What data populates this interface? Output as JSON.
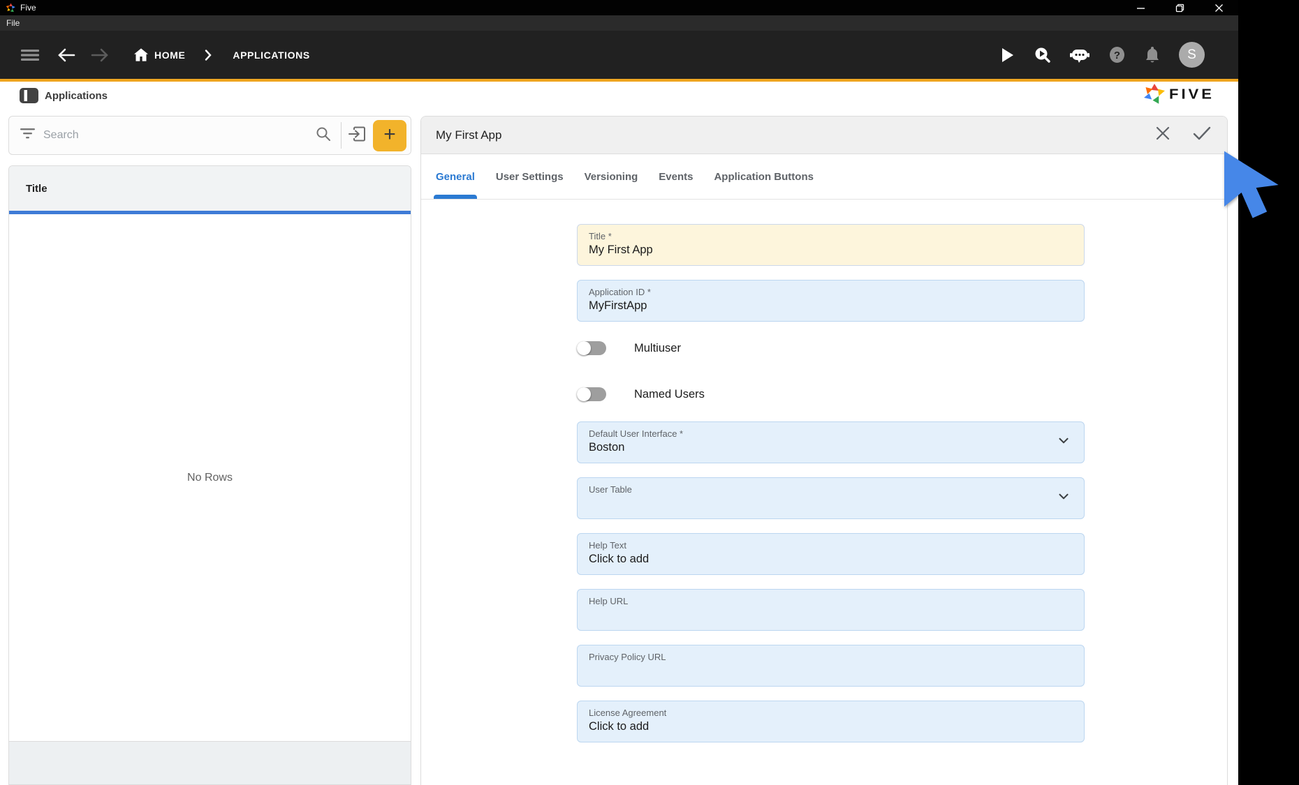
{
  "window": {
    "title": "Five",
    "menu_items": [
      "File"
    ],
    "controls": {
      "minimize": "minimize",
      "maximize": "restore",
      "close": "close"
    }
  },
  "navbar": {
    "breadcrumb_home": "HOME",
    "breadcrumb_current": "APPLICATIONS",
    "right_icons": [
      "run",
      "debug",
      "bot-assistant",
      "help",
      "notifications",
      "account"
    ],
    "avatar_initial": "S"
  },
  "brand": {
    "logo_text": "FIVE"
  },
  "left_panel": {
    "header": "Applications",
    "search": {
      "placeholder": "Search"
    },
    "column_header": "Title",
    "empty_text": "No Rows",
    "plus_label": "+"
  },
  "form_panel": {
    "title": "My First App",
    "tabs": [
      {
        "label": "General",
        "active": true
      },
      {
        "label": "User Settings",
        "active": false
      },
      {
        "label": "Versioning",
        "active": false
      },
      {
        "label": "Events",
        "active": false
      },
      {
        "label": "Application Buttons",
        "active": false
      }
    ],
    "fields": [
      {
        "label": "Title *",
        "value": "My First App",
        "variant": "amber"
      },
      {
        "label": "Application ID *",
        "value": "MyFirstApp",
        "variant": "blue"
      },
      {
        "label": "Default User Interface *",
        "value": "Boston",
        "variant": "blue-select"
      },
      {
        "label": "User Table",
        "value": "",
        "variant": "blue-select"
      },
      {
        "label": "Help Text",
        "value": "Click to add",
        "variant": "blue"
      },
      {
        "label": "Help URL",
        "value": "",
        "variant": "blue"
      },
      {
        "label": "Privacy Policy URL",
        "value": "",
        "variant": "blue"
      },
      {
        "label": "License Agreement",
        "value": "Click to add",
        "variant": "blue"
      }
    ],
    "toggles": [
      {
        "label": "Multiuser",
        "state": "off"
      },
      {
        "label": "Named Users",
        "state": "off"
      }
    ]
  },
  "colors": {
    "accent_yellow": "#EFA51F",
    "plus_button_yellow": "#F2B32B",
    "accent_blue": "#2b7ad2",
    "list_accent_blue": "#3E7BD6",
    "field_blue_bg": "#E4F0FB",
    "field_amber_bg": "#FDF5DC",
    "titlebar": "#020202",
    "menubar": "#2b2b2b",
    "navbar": "#212121",
    "cursor_blue": "#4687E8"
  }
}
